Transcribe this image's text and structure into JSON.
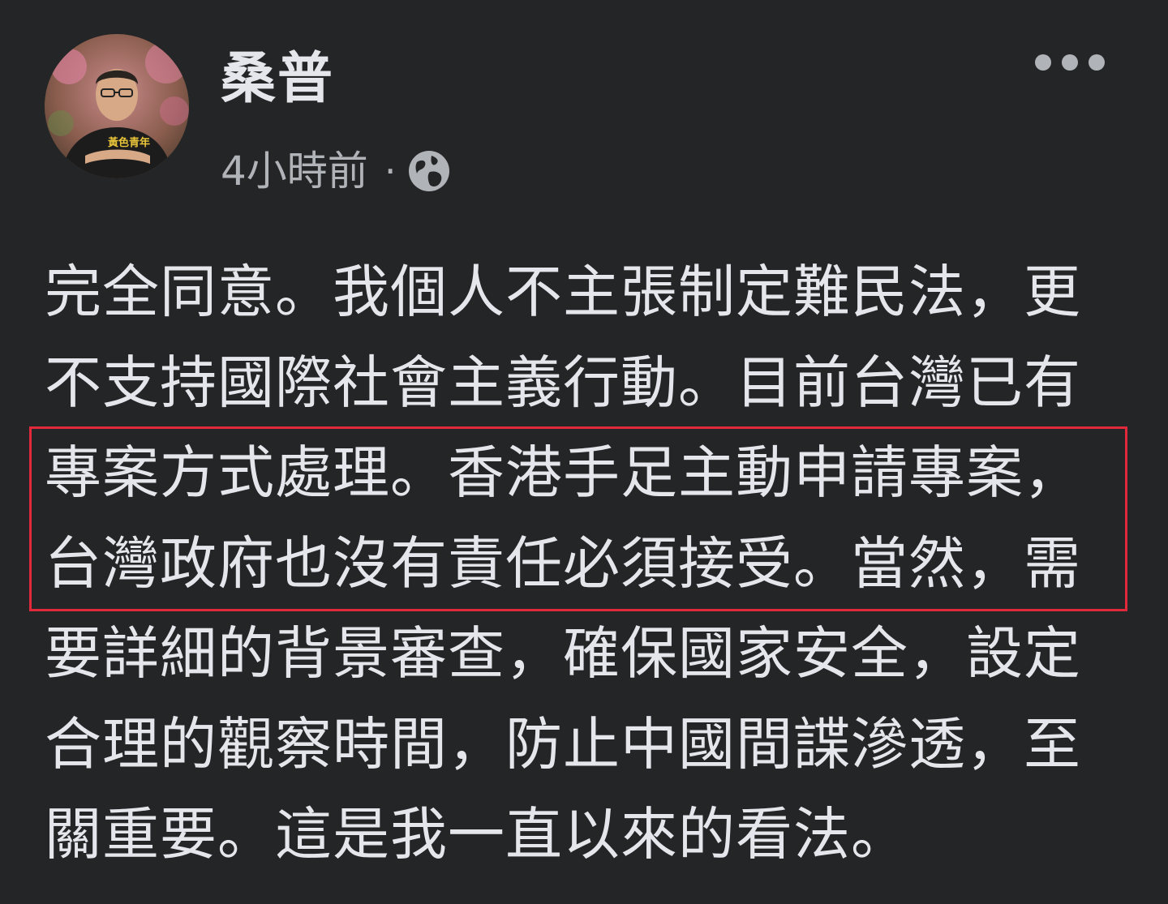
{
  "post": {
    "author_name": "桑普",
    "timestamp": "4小時前",
    "separator": "·",
    "privacy_icon": "globe-icon",
    "more_icon": "more-options-icon",
    "lines": [
      "完全同意。我個人不主張制定難民法，更",
      "不支持國際社會主義行動。目前台灣已有",
      "專案方式處理。香港手足主動申請專案，",
      "台灣政府也沒有責任必須接受。當然，需",
      "要詳細的背景審查，確保國家安全，設定",
      "合理的觀察時間，防止中國間諜滲透，至",
      "關重要。這是我一直以來的看法。"
    ],
    "avatar_shirt_text": "黃色青年"
  },
  "colors": {
    "background": "#242526",
    "text_primary": "#e4e6eb",
    "text_secondary": "#b0b3b8",
    "highlight_border": "#e1293b"
  }
}
